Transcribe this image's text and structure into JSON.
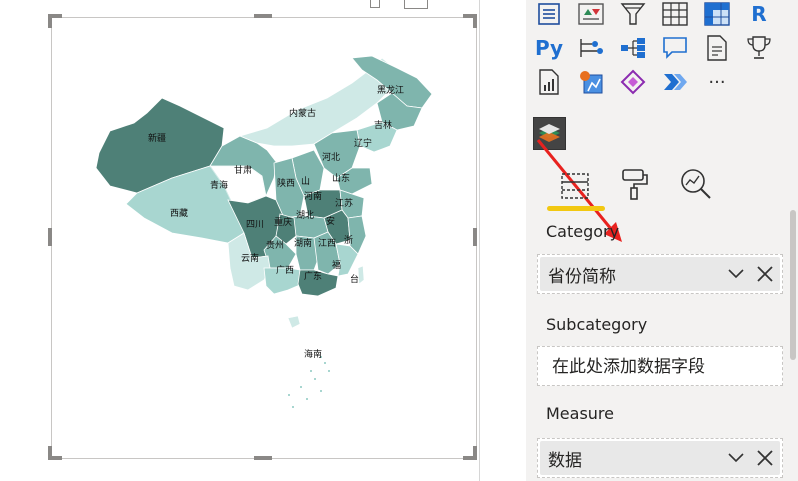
{
  "map": {
    "labels": {
      "xinjiang": "新疆",
      "neimenggu": "内蒙古",
      "heilongjiang": "黑龙江",
      "jilin": "吉林",
      "liaoning": "辽宁",
      "gansu": "甘肃",
      "qinghai": "青海",
      "xizang": "西藏",
      "hebei": "河北",
      "shanxi": "山",
      "shaanxi": "陕西",
      "shandong": "山东",
      "henan": "河南",
      "jiangsu": "江苏",
      "sichuan": "四川",
      "chongqing": "重庆",
      "hubei": "湖北",
      "anhui": "安",
      "zhejiang": "浙",
      "guizhou": "贵州",
      "hunan": "湖南",
      "jiangxi": "江西",
      "yunnan": "云南",
      "guangxi": "广西",
      "guangdong": "广东",
      "fujian": "福",
      "taiwan": "台",
      "hainan": "海南"
    }
  },
  "toolbar_icons": [
    "table-icon",
    "kpi-icon",
    "filter-icon",
    "grid-icon",
    "matrix-icon",
    "r-script-icon",
    "python-icon",
    "decomposition-tree-icon",
    "hierarchy-icon",
    "qna-icon",
    "paginated-report-icon",
    "trophy-icon",
    "report-icon",
    "map-custom-icon",
    "power-apps-icon",
    "power-automate-icon",
    "more-icon",
    "flowmap-visual-icon"
  ],
  "glyphs": {
    "r": "R",
    "py": "Py",
    "more": "···"
  },
  "tabs": {
    "fields": "fields-icon",
    "format": "paint-roller-icon",
    "analytics": "analytics-icon"
  },
  "fields": {
    "category_label": "Category",
    "category_value": "省份简称",
    "subcategory_label": "Subcategory",
    "subcategory_placeholder": "在此处添加数据字段",
    "measure_label": "Measure",
    "measure_value": "数据"
  },
  "colors": {
    "accent": "#f2c811",
    "arrow": "#e8221f",
    "map_dark": "#4e8077",
    "map_mid": "#7fb5ad",
    "map_light": "#a8d6d0",
    "map_pale": "#cfe9e6"
  }
}
